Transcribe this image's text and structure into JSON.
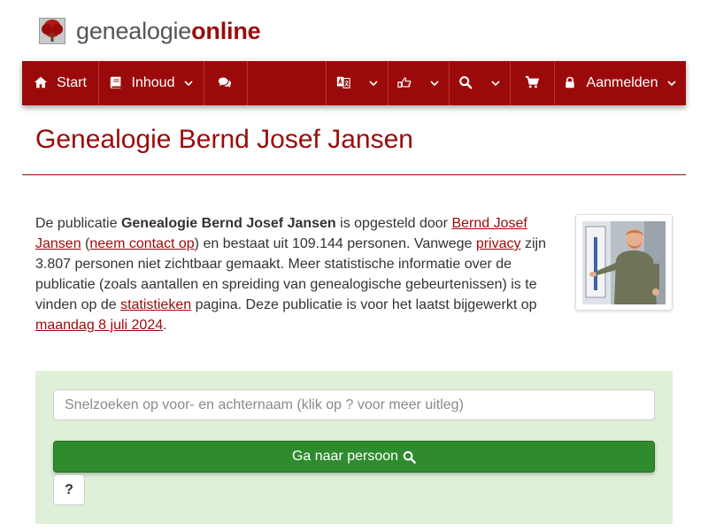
{
  "brand": {
    "part1": "genealogie",
    "part2": "online"
  },
  "nav": {
    "start_label": "Start",
    "inhoud_label": "Inhoud",
    "login_label": "Aanmelden",
    "icons": [
      "home-icon",
      "book-icon",
      "comments-icon",
      "language-icon",
      "share-icon",
      "search-icon",
      "cart-icon",
      "lock-icon"
    ]
  },
  "page": {
    "title": "Genealogie Bernd Josef Jansen"
  },
  "intro": {
    "t1": "De publicatie ",
    "pub_name": "Genealogie Bernd Josef Jansen",
    "t2": " is opgesteld door ",
    "author_link": "Bernd Josef Jansen",
    "t3": " (",
    "contact_link": "neem contact op",
    "t4": ") en bestaat uit 109.144 personen. Vanwege ",
    "privacy_link": "privacy",
    "t5": " zijn 3.807 personen niet zichtbaar gemaakt. Meer statistische informatie over de publicatie (zoals aantallen en spreiding van genealogische gebeurtenissen) is te vinden op de ",
    "stats_link": "statistieken",
    "t6": " pagina. Deze publicatie is voor het laatst bijgewerkt op ",
    "date_link": "maandag 8 juli 2024",
    "t7": "."
  },
  "search": {
    "placeholder": "Snelzoeken op voor- en achternaam (klik op ? voor meer uitleg)",
    "button_label": "Ga naar persoon",
    "help_label": "?"
  },
  "colors": {
    "brand": "#9b0a0a",
    "panel": "#dff0d8",
    "button": "#2e8b2e"
  }
}
